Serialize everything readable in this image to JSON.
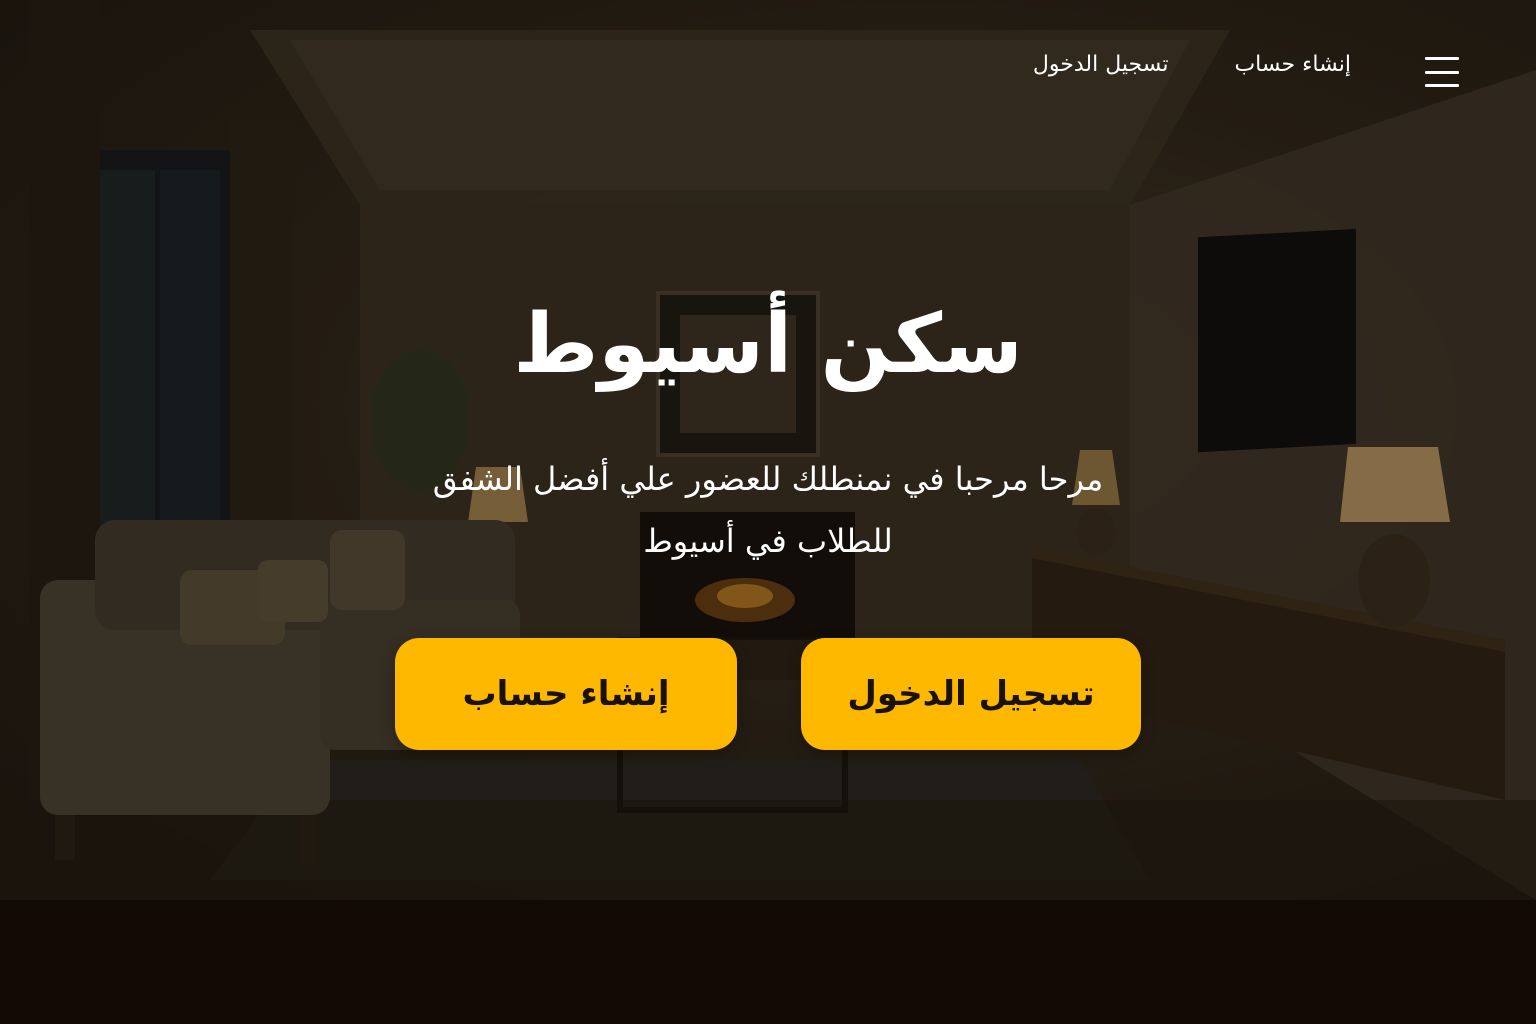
{
  "nav": {
    "menu_icon": "hamburger-menu-icon",
    "links": [
      {
        "label": "إنشاء حساب"
      },
      {
        "label": "تسجيل الدخول"
      }
    ]
  },
  "hero": {
    "title": "سكن أسيوط",
    "subtitle": "مرحا  مرحبا  في نمنطلك للعضور علي أفضل الشفق للطلاب في أسيوط",
    "buttons": {
      "login": "تسجيل الدخول",
      "signup": "إنشاء حساب"
    },
    "background": "dim-living-room-photo"
  },
  "colors": {
    "accent": "#ffb800",
    "text_on_dark": "#ffffff",
    "button_text": "#1a1208",
    "footer_band": "#140a05"
  }
}
